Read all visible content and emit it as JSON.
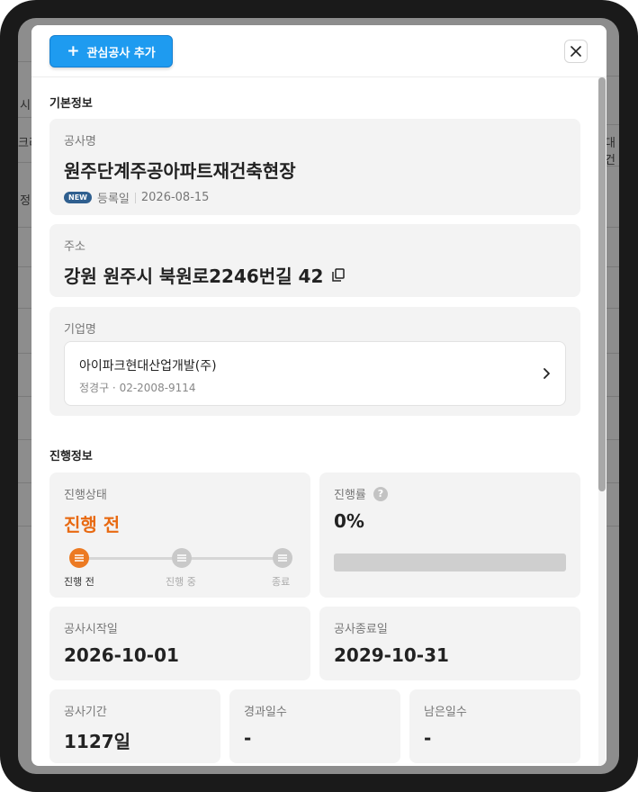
{
  "background": {
    "fragments": [
      "시",
      "크리",
      "정",
      "대건"
    ]
  },
  "header": {
    "add_button_label": "관심공사 추가",
    "plus_glyph": "+"
  },
  "basic_info": {
    "section_title": "기본정보",
    "project": {
      "label": "공사명",
      "name": "원주단계주공아파트재건축현장",
      "badge": "NEW",
      "reg_label": "등록일",
      "reg_date": "2026-08-15"
    },
    "address": {
      "label": "주소",
      "value": "강원 원주시 북원로2246번길 42"
    },
    "company": {
      "label": "기업명",
      "name": "아이파크현대산업개발(주)",
      "contact": "정경구 · 02-2008-9114"
    }
  },
  "progress_info": {
    "section_title": "진행정보",
    "status": {
      "label": "진행상태",
      "value": "진행 전",
      "steps": [
        "진행 전",
        "진행 중",
        "종료"
      ],
      "active_step": 0
    },
    "rate": {
      "label": "진행률",
      "value": "0%",
      "fraction": 0
    },
    "start_date": {
      "label": "공사시작일",
      "value": "2026-10-01"
    },
    "end_date": {
      "label": "공사종료일",
      "value": "2029-10-31"
    },
    "period": {
      "label": "공사기간",
      "value": "1127일"
    },
    "elapsed": {
      "label": "경과일수",
      "value": "-"
    },
    "remaining": {
      "label": "남은일수",
      "value": "-"
    }
  },
  "colors": {
    "accent_blue": "#1e9bf0",
    "status_orange": "#e86a12",
    "badge_navy": "#2f5f8f",
    "card_bg": "#f3f3f3"
  }
}
